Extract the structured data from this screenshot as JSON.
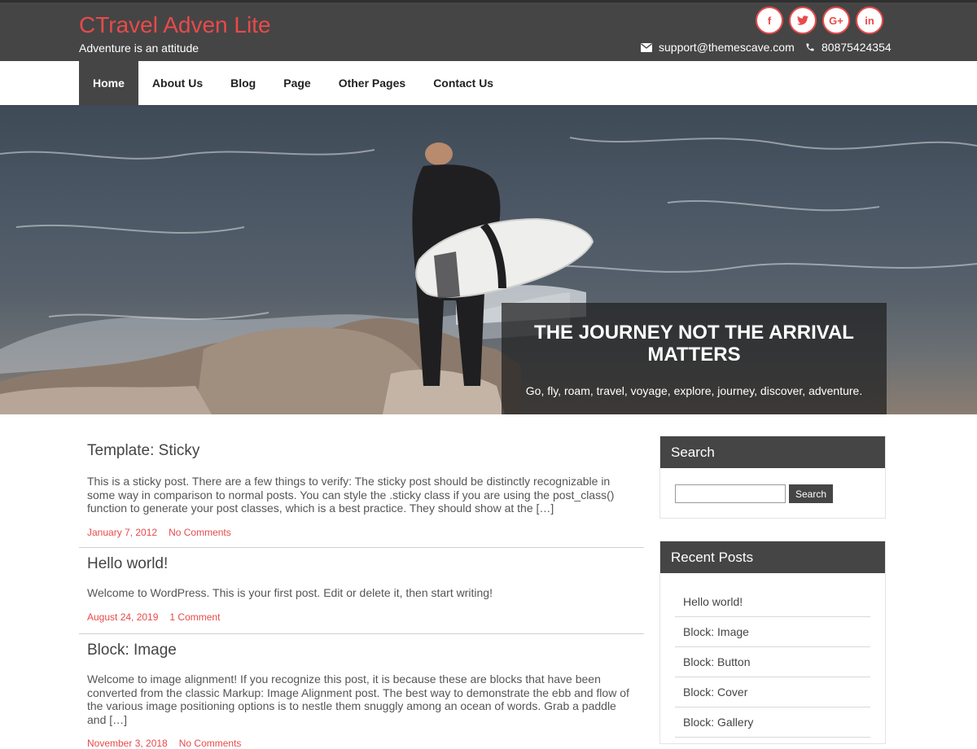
{
  "header": {
    "site_title": "CTravel Adven Lite",
    "tagline": "Adventure is an attitude",
    "socials": [
      {
        "icon": "facebook-icon",
        "glyph": "f"
      },
      {
        "icon": "twitter-icon",
        "glyph": "t"
      },
      {
        "icon": "google-plus-icon",
        "glyph": "G+"
      },
      {
        "icon": "linkedin-icon",
        "glyph": "in"
      }
    ],
    "email": "support@themescave.com",
    "phone": "80875424354"
  },
  "nav": {
    "items": [
      {
        "label": "Home",
        "active": true
      },
      {
        "label": "About Us"
      },
      {
        "label": "Blog"
      },
      {
        "label": "Page"
      },
      {
        "label": "Other Pages"
      },
      {
        "label": "Contact Us"
      }
    ]
  },
  "hero": {
    "title": "THE JOURNEY NOT THE ARRIVAL MATTERS",
    "subtitle": "Go, fly, roam, travel, voyage, explore, journey, discover, adventure."
  },
  "posts": [
    {
      "title": "Template: Sticky",
      "excerpt": "This is a sticky post. There are a few things to verify: The sticky post should be distinctly recognizable in some way in comparison to normal posts. You can style the .sticky class if you are using the post_class() function to generate your post classes, which is a best practice. They should show at the […]",
      "date": "January 7, 2012",
      "comments": "No Comments"
    },
    {
      "title": "Hello world!",
      "excerpt": "Welcome to WordPress. This is your first post. Edit or delete it, then start writing!",
      "date": "August 24, 2019",
      "comments": "1 Comment"
    },
    {
      "title": "Block: Image",
      "excerpt": "Welcome to image alignment! If you recognize this post, it is because these are blocks that have been converted from the classic Markup: Image Alignment post. The best way to demonstrate the ebb and flow of the various image positioning options is to nestle them snuggly among an ocean of words. Grab a paddle and […]",
      "date": "November 3, 2018",
      "comments": "No Comments"
    }
  ],
  "sidebar": {
    "search": {
      "title": "Search",
      "button": "Search",
      "value": ""
    },
    "recent": {
      "title": "Recent Posts",
      "items": [
        "Hello world!",
        "Block: Image",
        "Block: Button",
        "Block: Cover",
        "Block: Gallery"
      ]
    }
  },
  "colors": {
    "accent": "#e84a4a",
    "header_bg": "#454545"
  }
}
